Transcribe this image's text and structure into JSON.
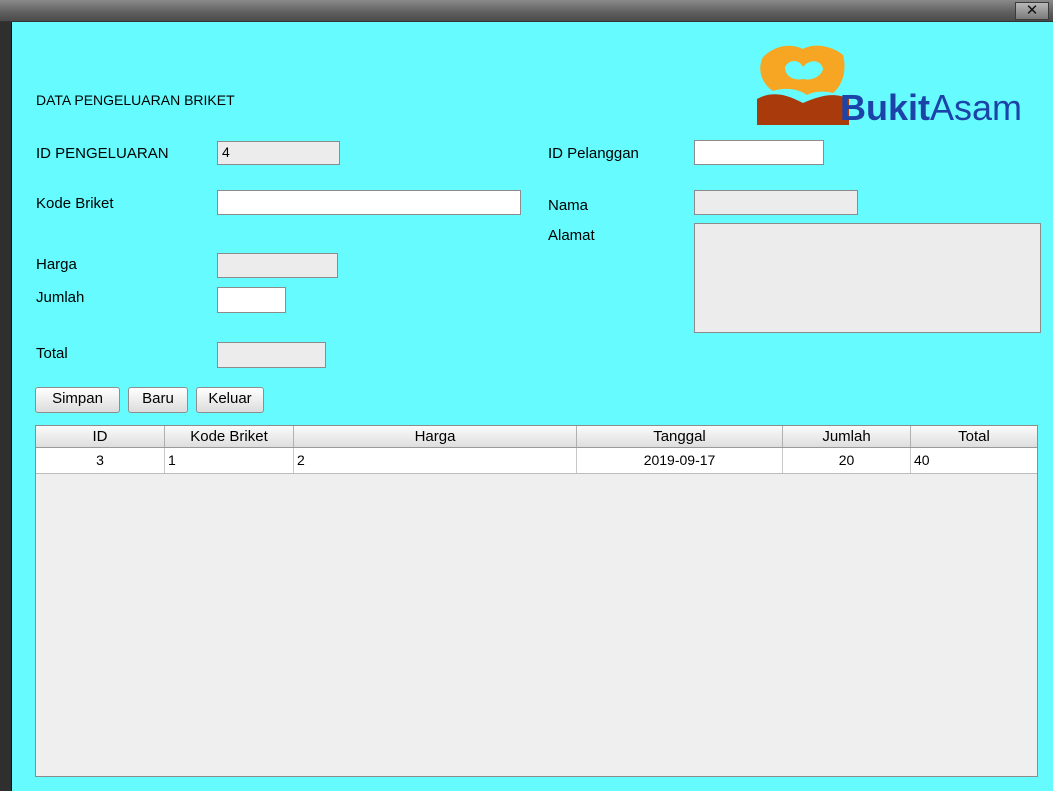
{
  "window": {
    "close_glyph": "✕"
  },
  "logo": {
    "text_bold": "Bukit",
    "text_regular": "Asam",
    "colors": {
      "orange": "#f6a623",
      "brown": "#a83a0c",
      "blue": "#1b43a8"
    }
  },
  "form": {
    "title": "DATA PENGELUARAN BRIKET",
    "id_pengeluaran": {
      "label": "ID PENGELUARAN",
      "value": "4"
    },
    "kode_briket": {
      "label": "Kode Briket",
      "value": ""
    },
    "harga": {
      "label": "Harga",
      "value": ""
    },
    "jumlah": {
      "label": "Jumlah",
      "value": ""
    },
    "total": {
      "label": "Total",
      "value": ""
    },
    "id_pelanggan": {
      "label": "ID Pelanggan",
      "value": ""
    },
    "nama": {
      "label": "Nama",
      "value": ""
    },
    "alamat": {
      "label": "Alamat",
      "value": ""
    }
  },
  "buttons": {
    "simpan": "Simpan",
    "baru": "Baru",
    "keluar": "Keluar"
  },
  "table": {
    "headers": [
      "ID",
      "Kode Briket",
      "Harga",
      "Tanggal",
      "Jumlah",
      "Total"
    ],
    "rows": [
      [
        "3",
        "1",
        "2",
        "2019-09-17",
        "20",
        "40"
      ]
    ]
  }
}
